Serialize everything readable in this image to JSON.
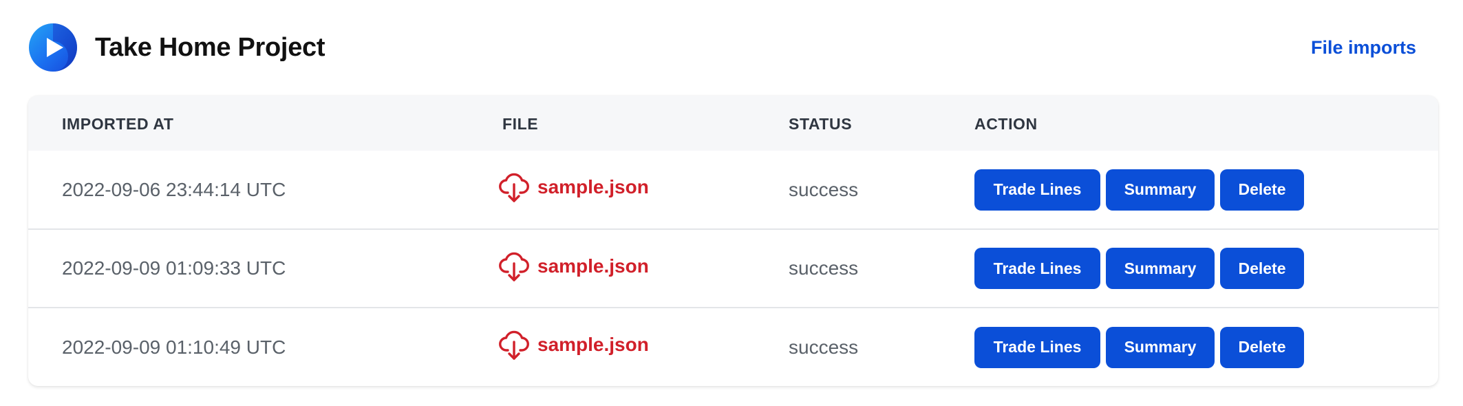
{
  "app": {
    "title": "Take Home Project",
    "logo_icon": "play-logo-icon"
  },
  "nav": {
    "file_imports": "File imports"
  },
  "colors": {
    "primary": "#0b4fd8",
    "file_link": "#d1202a",
    "header_bg": "#f6f7f9"
  },
  "table": {
    "headers": {
      "imported_at": "IMPORTED AT",
      "file": "FILE",
      "status": "STATUS",
      "action": "ACTION"
    },
    "rows": [
      {
        "imported_at": "2022-09-06 23:44:14 UTC",
        "file": "sample.json",
        "file_icon": "cloud-download-icon",
        "status": "success",
        "actions": {
          "trade_lines": "Trade Lines",
          "summary": "Summary",
          "delete": "Delete"
        }
      },
      {
        "imported_at": "2022-09-09 01:09:33 UTC",
        "file": "sample.json",
        "file_icon": "cloud-download-icon",
        "status": "success",
        "actions": {
          "trade_lines": "Trade Lines",
          "summary": "Summary",
          "delete": "Delete"
        }
      },
      {
        "imported_at": "2022-09-09 01:10:49 UTC",
        "file": "sample.json",
        "file_icon": "cloud-download-icon",
        "status": "success",
        "actions": {
          "trade_lines": "Trade Lines",
          "summary": "Summary",
          "delete": "Delete"
        }
      }
    ]
  }
}
